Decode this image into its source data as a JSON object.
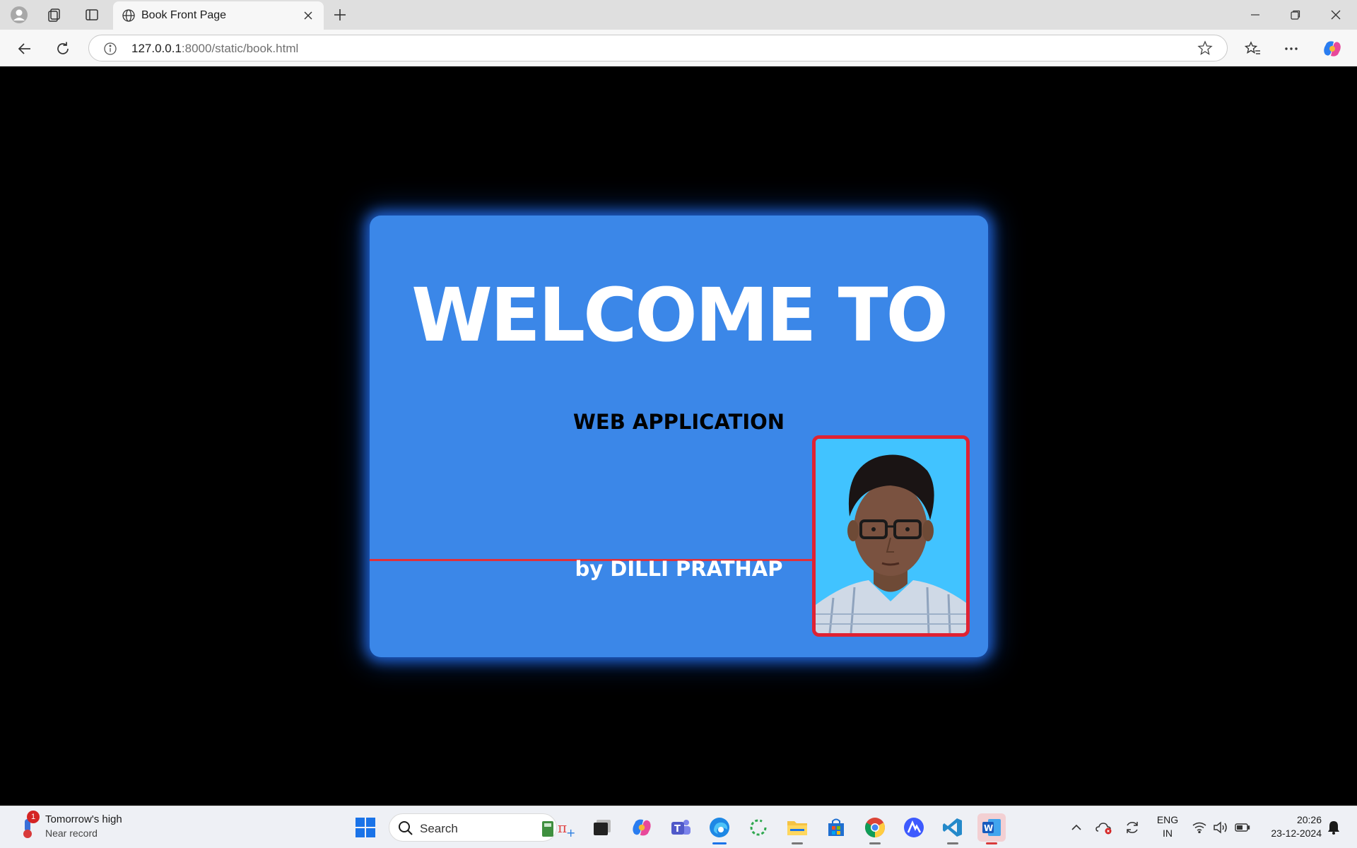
{
  "browser": {
    "tab_title": "Book Front Page",
    "url_host": "127.0.0.1",
    "url_path": ":8000/static/book.html"
  },
  "page": {
    "heading": "WELCOME TO",
    "subtitle": "WEB APPLICATION",
    "author": "by DILLI PRATHAP",
    "card_color": "#3b87e8",
    "accent_color": "#e02232"
  },
  "taskbar": {
    "weather_title": "Tomorrow's high",
    "weather_sub": "Near record",
    "weather_badge": "1",
    "search_label": "Search",
    "lang_line1": "ENG",
    "lang_line2": "IN",
    "time": "20:26",
    "date": "23-12-2024",
    "apps": [
      "start-icon",
      "search",
      "calculator-icon",
      "task-view-icon",
      "copilot-icon",
      "teams-icon",
      "edge-icon",
      "sync-icon",
      "file-explorer-icon",
      "store-icon",
      "chrome-icon",
      "app-icon",
      "vscode-icon",
      "word-icon"
    ]
  }
}
